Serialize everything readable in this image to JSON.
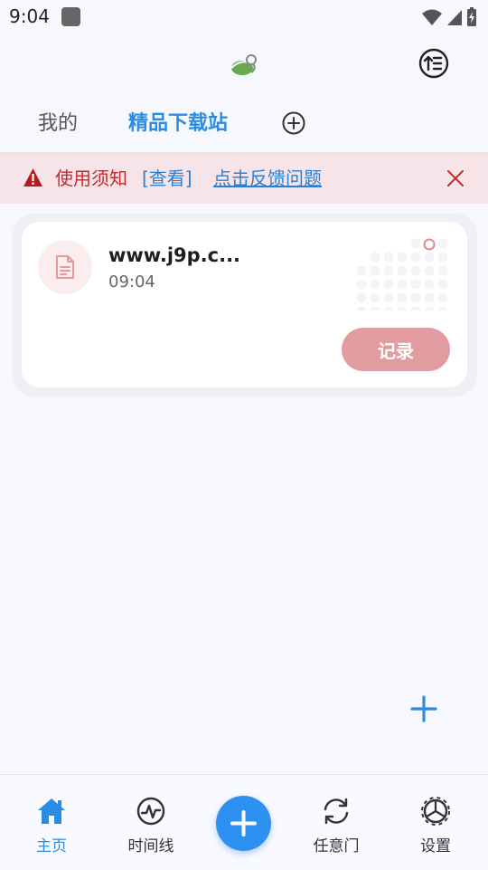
{
  "status": {
    "time": "9:04"
  },
  "tabs": {
    "mine": "我的",
    "premium": "精品下载站"
  },
  "notice": {
    "title": "使用须知",
    "view": "[查看]",
    "feedback": "点击反馈问题"
  },
  "card": {
    "title": "www.j9p.c...",
    "time": "09:04",
    "record_label": "记录"
  },
  "nav": {
    "home": "主页",
    "timeline": "时间线",
    "portal": "任意门",
    "settings": "设置"
  },
  "colors": {
    "accent": "#2a8de3",
    "warning": "#c02c2c",
    "record_button": "#e29c9f",
    "notice_bg": "#f6e4e8"
  },
  "icons": {
    "status": [
      "app-icon",
      "wifi-icon",
      "signal-icon",
      "battery-icon"
    ],
    "appbar": [
      "logo-icon",
      "sort-upload-icon"
    ],
    "tabs": [
      "add-circle-icon"
    ],
    "notice": [
      "warning-icon",
      "close-icon"
    ],
    "card": [
      "document-icon"
    ],
    "misc": [
      "plus-icon"
    ],
    "nav": [
      "home-icon",
      "timeline-icon",
      "add-icon",
      "sync-icon",
      "settings-icon"
    ]
  }
}
